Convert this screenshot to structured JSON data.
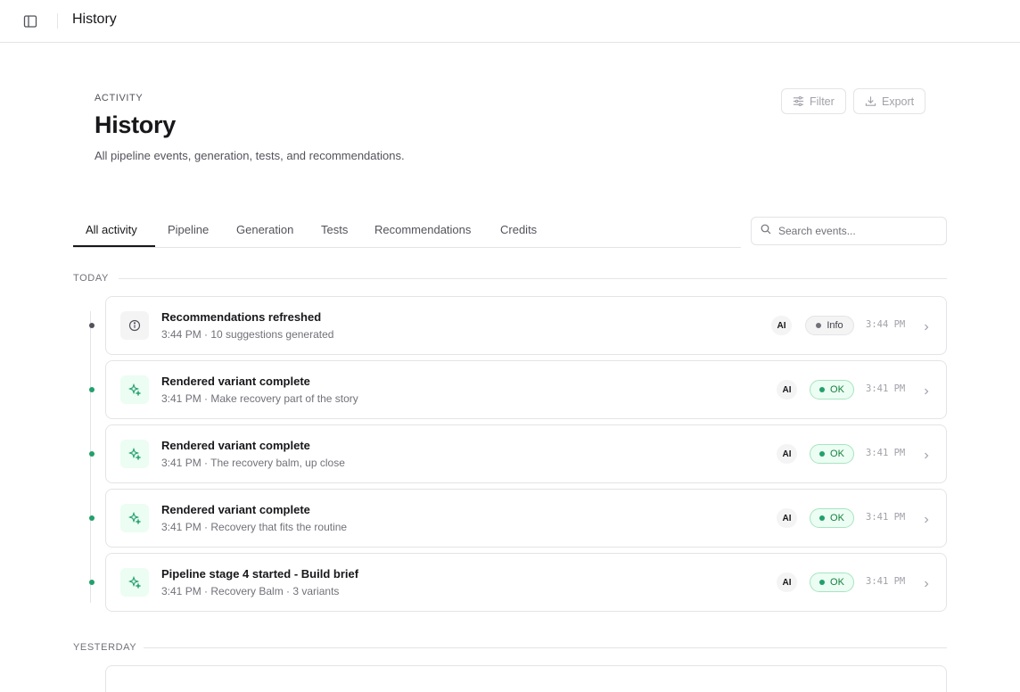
{
  "topbar": {
    "title": "History"
  },
  "header": {
    "eyebrow": "ACTIVITY",
    "title": "History",
    "subtitle": "All pipeline events, generation, tests, and recommendations.",
    "filter_label": "Filter",
    "export_label": "Export"
  },
  "tabs": [
    {
      "label": "All activity",
      "active": true
    },
    {
      "label": "Pipeline",
      "active": false
    },
    {
      "label": "Generation",
      "active": false
    },
    {
      "label": "Tests",
      "active": false
    },
    {
      "label": "Recommendations",
      "active": false
    },
    {
      "label": "Credits",
      "active": false
    }
  ],
  "search": {
    "placeholder": "Search events..."
  },
  "sections": {
    "today": "TODAY",
    "yesterday": "YESTERDAY"
  },
  "events": [
    {
      "icon": "info-icon",
      "title": "Recommendations refreshed",
      "subtitle": "3:44 PM · 10 suggestions generated",
      "badge": "AI",
      "status": "Info",
      "status_kind": "info",
      "time": "3:44 PM"
    },
    {
      "icon": "sparkle-icon",
      "title": "Rendered variant complete",
      "subtitle": "3:41 PM · Make recovery part of the story",
      "badge": "AI",
      "status": "OK",
      "status_kind": "ok",
      "time": "3:41 PM"
    },
    {
      "icon": "sparkle-icon",
      "title": "Rendered variant complete",
      "subtitle": "3:41 PM · The recovery balm, up close",
      "badge": "AI",
      "status": "OK",
      "status_kind": "ok",
      "time": "3:41 PM"
    },
    {
      "icon": "sparkle-icon",
      "title": "Rendered variant complete",
      "subtitle": "3:41 PM · Recovery that fits the routine",
      "badge": "AI",
      "status": "OK",
      "status_kind": "ok",
      "time": "3:41 PM"
    },
    {
      "icon": "sparkle-icon",
      "title": "Pipeline stage 4 started - Build brief",
      "subtitle": "3:41 PM · Recovery Balm · 3 variants",
      "badge": "AI",
      "status": "OK",
      "status_kind": "ok",
      "time": "3:41 PM"
    }
  ],
  "colors": {
    "ok_green": "#22a06b",
    "ok_bg": "#ecfdf3",
    "border": "#e4e4e7"
  }
}
